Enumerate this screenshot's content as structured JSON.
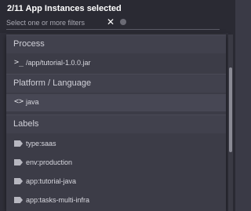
{
  "header": {
    "title": "2/11 App Instances selected",
    "filter_placeholder": "Select one or more filters",
    "clear_symbol": "✕"
  },
  "sections": {
    "process": {
      "title": "Process",
      "items": [
        {
          "icon": "terminal-icon",
          "glyph": ">_",
          "label": "/app/tutorial-1.0.0.jar"
        }
      ]
    },
    "platform": {
      "title": "Platform / Language",
      "items": [
        {
          "icon": "code-icon",
          "glyph": "<>",
          "label": "java"
        }
      ]
    },
    "labels": {
      "title": "Labels",
      "items": [
        {
          "icon": "tag-icon",
          "label": "type:saas"
        },
        {
          "icon": "tag-icon",
          "label": "env:production"
        },
        {
          "icon": "tag-icon",
          "label": "app:tutorial-java"
        },
        {
          "icon": "tag-icon",
          "label": "app:tasks-multi-infra"
        }
      ]
    }
  },
  "colors": {
    "background": "#2f2f39",
    "panel": "#3c3c47",
    "section_header": "#41414d",
    "selected_row": "#474754",
    "scroll_thumb": "#8a8a94"
  }
}
